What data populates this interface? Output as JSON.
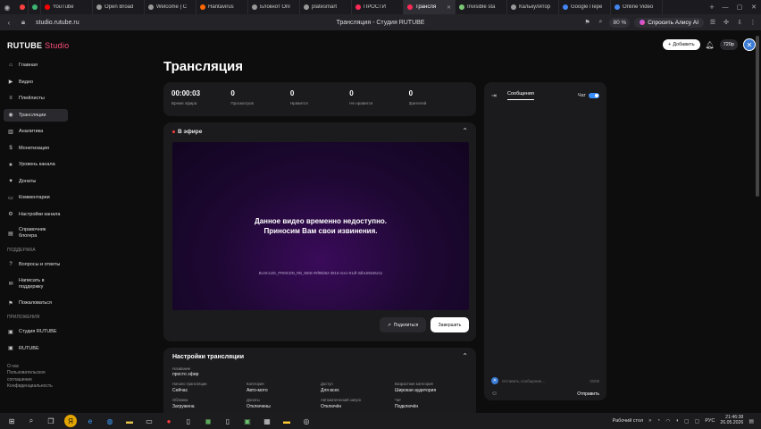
{
  "browser": {
    "tabs": [
      {
        "label": "",
        "color": "#ff4040"
      },
      {
        "label": "",
        "color": "#3cb371"
      },
      {
        "label": "YouTube",
        "color": "#ff0000"
      },
      {
        "label": "Open Broad",
        "color": "#999999"
      },
      {
        "label": "Welcome | C",
        "color": "#999999"
      },
      {
        "label": "Hantavirus",
        "color": "#ff6600"
      },
      {
        "label": "Блокнот Onl",
        "color": "#999999"
      },
      {
        "label": "platesmart",
        "color": "#999999"
      },
      {
        "label": "ПРОСТИ",
        "color": "#ff2a55"
      },
      {
        "label": "Трансля",
        "color": "#ff2a55",
        "active": true
      },
      {
        "label": "Invisible sta",
        "color": "#7cc576"
      },
      {
        "label": "Калькулятор",
        "color": "#999999"
      },
      {
        "label": "Google Пере",
        "color": "#4285f4"
      },
      {
        "label": "Online Video",
        "color": "#4285f4"
      }
    ],
    "url": "studio.rutube.ru",
    "page_title": "Трансляция - Студия RUTUBE",
    "zoom": "80 %",
    "alice": "Спросить Алису AI"
  },
  "app": {
    "logo_main": "RUTUBE",
    "logo_sub": "Studio",
    "add_button": "Добавить",
    "quality": "720p"
  },
  "sidebar": {
    "items": [
      {
        "label": "Главная",
        "icon": "home-icon"
      },
      {
        "label": "Видео",
        "icon": "video-icon"
      },
      {
        "label": "Плейлисты",
        "icon": "playlist-icon"
      },
      {
        "label": "Трансляции",
        "icon": "broadcast-icon",
        "active": true
      },
      {
        "label": "Аналитика",
        "icon": "analytics-icon"
      },
      {
        "label": "Монетизация",
        "icon": "money-icon"
      },
      {
        "label": "Уровень канала",
        "icon": "star-icon"
      },
      {
        "label": "Донаты",
        "icon": "donate-icon"
      },
      {
        "label": "Комментарии",
        "icon": "comments-icon"
      },
      {
        "label": "Настройки канала",
        "icon": "settings-icon"
      },
      {
        "label": "Справочник блогера",
        "icon": "book-icon"
      }
    ],
    "support_label": "ПОДДЕРЖКА",
    "support_items": [
      {
        "label": "Вопросы и ответы",
        "icon": "help-icon"
      },
      {
        "label": "Написать в поддержку",
        "icon": "mail-icon"
      },
      {
        "label": "Пожаловаться",
        "icon": "flag-icon"
      }
    ],
    "apps_label": "ПРИЛОЖЕНИЯ",
    "apps_items": [
      {
        "label": "Студия RUTUBE",
        "icon": "studio-app-icon"
      },
      {
        "label": "RUTUBE",
        "icon": "rutube-app-icon"
      }
    ],
    "footer_about": "О нас",
    "footer_terms": "Пользовательское соглашение",
    "footer_privacy": "Конфиденциальность"
  },
  "main": {
    "title": "Трансляция",
    "stats": [
      {
        "value": "00:00:03",
        "label": "Время эфира"
      },
      {
        "value": "0",
        "label": "Просмотров"
      },
      {
        "value": "0",
        "label": "Нравится"
      },
      {
        "value": "0",
        "label": "Не нравится"
      },
      {
        "value": "0",
        "label": "Зрителей"
      }
    ],
    "live_label": "В эфире",
    "player_msg1": "Данное видео временно недоступно.",
    "player_msg2": "Приносим Вам свои извинения.",
    "player_code": "BLNCLDE_PRMCDN_RB_WEB #8f95b62-3915-4ce1-91df-3db155536211",
    "share_button": "Поделиться",
    "finish_button": "Завершить",
    "settings_title": "Настройки трансляции",
    "name_label": "Название",
    "name_value": "просто эфир",
    "settings_grid": [
      {
        "label": "Начало трансляции",
        "value": "Сейчас"
      },
      {
        "label": "Категория",
        "value": "Авто-мото"
      },
      {
        "label": "Доступ",
        "value": "Для всех"
      },
      {
        "label": "Возрастная категория",
        "value": "Широкая аудитория"
      },
      {
        "label": "Обложка",
        "value": "Загружена"
      },
      {
        "label": "Донаты",
        "value": "Отключены"
      },
      {
        "label": "Автоматический запуск",
        "value": "Отключён"
      },
      {
        "label": "Чат",
        "value": "Подключён"
      }
    ]
  },
  "chat": {
    "tab": "Сообщения",
    "toggle_label": "Чат",
    "placeholder": "Оставить сообщение...",
    "count": "0/200",
    "send": "Отправить"
  },
  "taskbar": {
    "desktop": "Рабочий стол",
    "lang": "РУС",
    "time": "21:46:38",
    "date": "26.05.2026"
  }
}
